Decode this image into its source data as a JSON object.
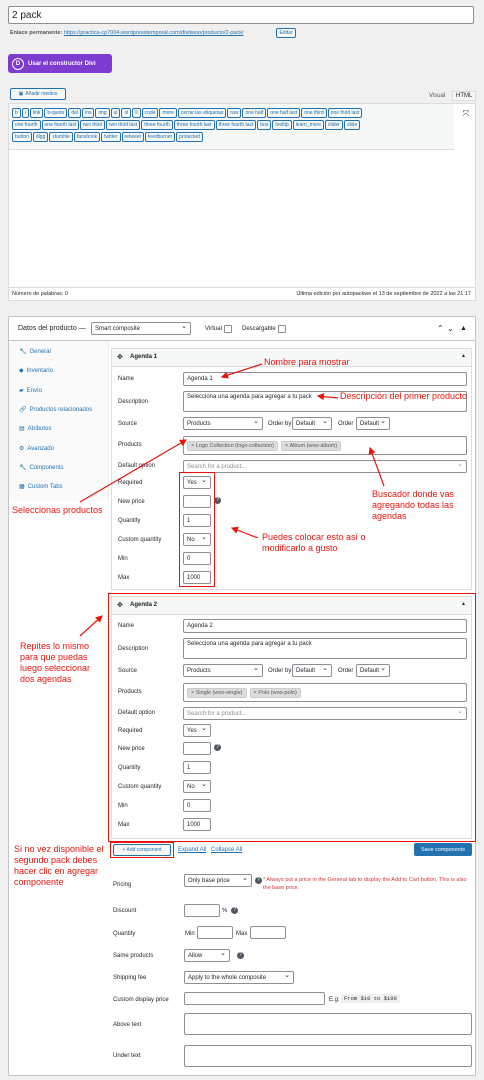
{
  "post_title": "2 pack",
  "permalink": {
    "label": "Enlace permanente:",
    "url": "https://practica-cp7004.wordpresstemporal.com/divitwoo/producto/2-pack/",
    "edit": "Editar"
  },
  "divi_button": "Usar el constructor Divi",
  "add_media": "Añadir medios",
  "editor_tabs": [
    "Visual",
    "HTML"
  ],
  "qt_row1": [
    "b",
    "i",
    "link",
    "b-quote",
    "del",
    "ins",
    "img",
    "ul",
    "ol",
    "li",
    "code",
    "more",
    "cerrar las etiquetas",
    "raw",
    "one half",
    "one half last",
    "one third",
    "one third last"
  ],
  "qt_row2": [
    "one fourth",
    "one fourth last",
    "two third",
    "two third last",
    "three fourth",
    "three fourth last",
    "three fourth last",
    "box",
    "tooltip",
    "learn_more",
    "slider",
    "slide"
  ],
  "qt_row3": [
    "button",
    "digg",
    "stumble",
    "facebook",
    "twitter",
    "retweet",
    "feedburner",
    "protected"
  ],
  "word_count": "Número de palabras: 0",
  "last_edit": "Última edición por autopackwe el 13 de septiembre de 2022 a las 21:17",
  "product_data": {
    "label": "Datos del producto —",
    "type": "Smart composite",
    "virtual": "Virtual",
    "downloadable": "Descargable"
  },
  "tabs": [
    "General",
    "Inventario",
    "Envío",
    "Productos relacionados",
    "Atributos",
    "Avanzado",
    "Components",
    "Custom Tabs"
  ],
  "labels": {
    "name": "Name",
    "description": "Description",
    "source": "Source",
    "products": "Products",
    "default_option": "Default option",
    "required": "Required",
    "new_price": "New price",
    "quantity": "Quantity",
    "custom_quantity": "Custom quantity",
    "min": "Min",
    "max": "Max",
    "order_by": "Order by",
    "order": "Order"
  },
  "agenda1": {
    "title": "Agenda 1",
    "name": "Agenda 1",
    "description": "Selecciona una agenda para agregar a tu pack",
    "source": "Products",
    "order_by": "Default",
    "order": "Default",
    "products": [
      "× Logo Collection (logo-collection)",
      "× Album (woo-album)"
    ],
    "default_placeholder": "Search for a product...",
    "required": "Yes",
    "new_price": "",
    "quantity": "1",
    "custom_quantity": "No",
    "min": "0",
    "max": "1000"
  },
  "agenda2": {
    "title": "Agenda 2",
    "name": "Agenda 2",
    "description": "Selecciona una agenda para agregar a tu pack",
    "source": "Products",
    "order_by": "Default",
    "order": "Default",
    "products": [
      "× Single (woo-single)",
      "× Polo (woo-polo)"
    ],
    "default_placeholder": "Search for a product...",
    "required": "Yes",
    "new_price": "",
    "quantity": "1",
    "custom_quantity": "No",
    "min": "0",
    "max": "1000"
  },
  "add_component": "+ Add component",
  "expand_all": "Expand All",
  "collapse_all": "Collapse All",
  "save_components": "Save components",
  "bottom": {
    "pricing": "Pricing",
    "pricing_value": "Only base price",
    "pricing_note": "* Always put a price in the General tab to display the Add to Cart button. This is also the base price.",
    "discount": "Discount",
    "discount_unit": "%",
    "quantity": "Quantity",
    "min": "Min",
    "max": "Max",
    "same_products": "Same products",
    "same_value": "Allow",
    "shipping_fee": "Shipping fee",
    "shipping_value": "Apply to the whole composite",
    "custom_price": "Custom display price",
    "custom_eg": "E.g:",
    "custom_eg_code": "From $10 to $100",
    "above_text": "Above text",
    "under_text": "Under text"
  },
  "annotations": {
    "nombre": "Nombre para mostrar",
    "descripcion": "Descripción del primer producto",
    "buscador": "Buscador donde vas agregando todas las agendas",
    "selecciona": "Seleccionas productos",
    "puedes": "Puedes colocar esto así o modificarlo a gusto",
    "repites": "Repites lo mismo para que puedas luego seleccionar dos agendas",
    "sino": "Si no vez disponible el segundo pack debes hacer clic en agregar componente"
  },
  "colors": {
    "annotation": "#e8140c",
    "accent": "#2271b1",
    "divi": "#7e3bd0"
  }
}
